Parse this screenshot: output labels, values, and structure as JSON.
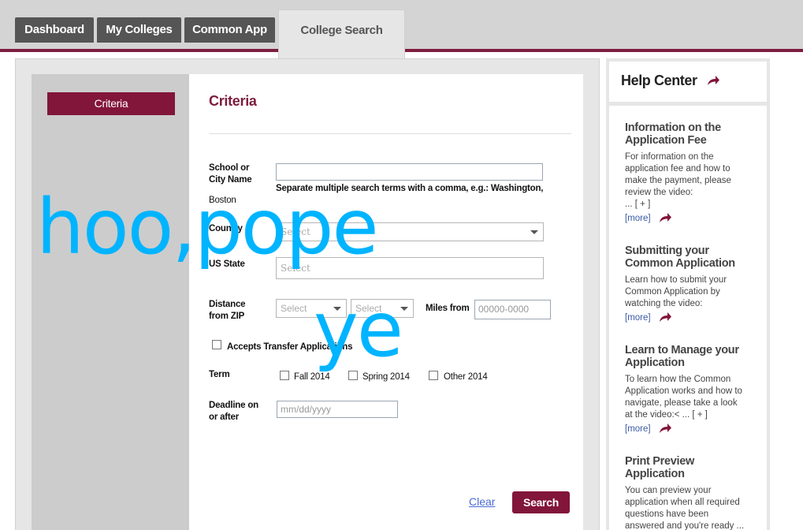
{
  "nav": {
    "tabs": [
      {
        "label": "Dashboard"
      },
      {
        "label": "My Colleges"
      },
      {
        "label": "Common App"
      },
      {
        "label": "College Search"
      }
    ]
  },
  "sidebar": {
    "criteria_label": "Criteria"
  },
  "form": {
    "heading": "Criteria",
    "school_label_1": "School or",
    "school_label_2": "City Name",
    "school_hint": "Separate multiple search terms with a comma, e.g.: Washington,",
    "school_hint_2": "Boston",
    "country_label": "Country",
    "country_select": "Select",
    "state_label": "US State",
    "state_select": "Select",
    "distance_label_1": "Distance",
    "distance_label_2": "from ZIP",
    "distance_select_1": "Select",
    "distance_select_2": "Select",
    "miles_from_label": "Miles from",
    "zip_placeholder": "00000-0000",
    "transfer_label": "Accepts Transfer Applications",
    "term_label": "Term",
    "term_options": [
      "Fall 2014",
      "Spring 2014",
      "Other 2014"
    ],
    "deadline_label_1": "Deadline on",
    "deadline_label_2": "or after",
    "deadline_placeholder": "mm/dd/yyyy",
    "clear_label": "Clear",
    "search_label": "Search"
  },
  "help": {
    "title": "Help Center",
    "items": [
      {
        "title_1": "Information on the",
        "title_2": "Application Fee",
        "lines": [
          "For information on the",
          "application fee and how to",
          "make the payment, please",
          "review the video:",
          "... [ + ]"
        ],
        "more": "[more]"
      },
      {
        "title_1": "Submitting your",
        "title_2": "Common Application",
        "lines": [
          "Learn how to submit your",
          "Common Application by",
          "watching the video:"
        ],
        "more": "[more]"
      },
      {
        "title_1": "Learn to Manage your",
        "title_2": "Application",
        "lines": [
          "To learn how the Common",
          "Application works and how to",
          "navigate, please take a look",
          "at the video:< ... [ + ]"
        ],
        "more": "[more]"
      },
      {
        "title_1": "Print Preview",
        "title_2": "Application",
        "lines": [
          "You can preview your",
          "application when all required",
          "questions have been",
          "answered and you're ready ..."
        ],
        "more": ""
      }
    ]
  },
  "overlay": {
    "line_1": "hoo,pope",
    "line_2": "ye"
  },
  "colors": {
    "brand": "#7d1d3f",
    "button": "#82153a",
    "overlay": "#00b4ff"
  }
}
